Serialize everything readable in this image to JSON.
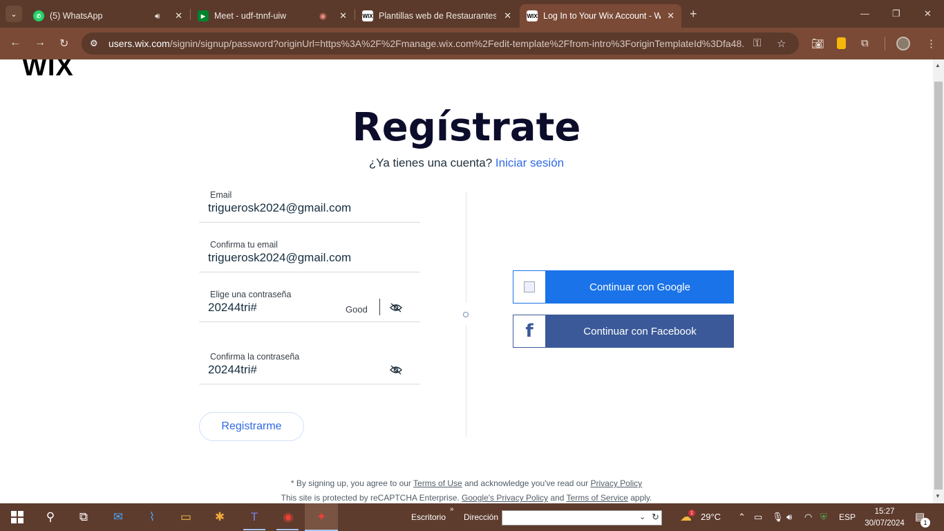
{
  "browser": {
    "tabs": [
      {
        "title": "(5) WhatsApp",
        "favicon": "whatsapp-icon",
        "extra": "speaker-icon"
      },
      {
        "title": "Meet - udf-tnnf-uiw",
        "favicon": "google-meet-icon",
        "extra": "recording-icon"
      },
      {
        "title": "Plantillas web de Restaurantes y",
        "favicon": "wix-icon"
      },
      {
        "title": "Log In to Your Wix Account - W",
        "favicon": "wix-icon",
        "active": true
      }
    ],
    "favicon_text": "WIX",
    "url_host": "users.wix.com",
    "url_path": "/signin/signup/password?originUrl=https%3A%2F%2Fmanage.wix.com%2Fedit-template%2Ffrom-intro%3ForiginTemplateId%3Dfa48..."
  },
  "page": {
    "logo": "WIX",
    "heading": "Regístrate",
    "subtitle_text": "¿Ya tienes una cuenta?",
    "login_link": "Iniciar sesión",
    "fields": {
      "email": {
        "label": "Email",
        "value": "triguerosk2024@gmail.com"
      },
      "confirm_email": {
        "label": "Confirma tu email",
        "value": "triguerosk2024@gmail.com"
      },
      "password": {
        "label": "Elige una contraseña",
        "value": "20244tri#",
        "strength": "Good"
      },
      "confirm_password": {
        "label": "Confirma la contraseña",
        "value": "20244tri#"
      }
    },
    "register_button": "Registrarme",
    "google_button": "Continuar con Google",
    "facebook_button": "Continuar con Facebook",
    "facebook_glyph": "f",
    "legal": {
      "line1_a": "* By signing up, you agree to our ",
      "terms_of_use": "Terms of Use",
      "line1_b": " and acknowledge you've read our ",
      "privacy_policy": "Privacy Policy",
      "line2_a": "This site is protected by reCAPTCHA Enterprise. ",
      "google_privacy": "Google's Privacy Policy",
      "line2_b": " and ",
      "terms_of_service": "Terms of Service",
      "line2_c": " apply."
    }
  },
  "taskbar": {
    "desktop_label": "Escritorio",
    "address_label": "Dirección",
    "temperature": "29°C",
    "language": "ESP",
    "time": "15:27",
    "date": "30/07/2024",
    "weather_badge": "1",
    "notification_count": "1"
  },
  "colors": {
    "accent_blue": "#2f6ae5",
    "google_blue": "#1a73e8",
    "facebook_blue": "#3b5998",
    "browser_frame": "#7a4a36"
  }
}
